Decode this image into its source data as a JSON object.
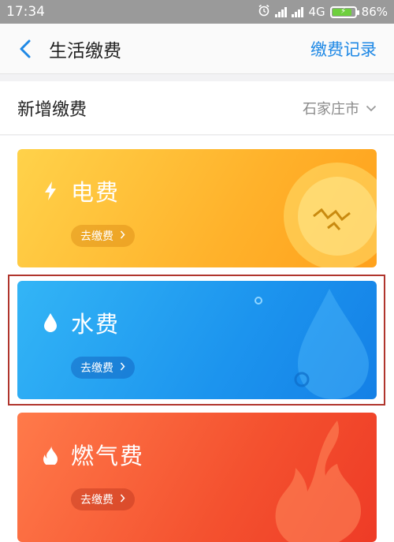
{
  "status_bar": {
    "time": "17:34",
    "network": "4G",
    "battery": "86%"
  },
  "header": {
    "title": "生活缴费",
    "right_link": "缴费记录"
  },
  "sub_header": {
    "title": "新增缴费",
    "city": "石家庄市"
  },
  "cards": [
    {
      "name": "电费",
      "action": "去缴费",
      "icon": "lightning-icon",
      "color": "#ffb22b"
    },
    {
      "name": "水费",
      "action": "去缴费",
      "icon": "water-drop-icon",
      "color": "#1c94ee"
    },
    {
      "name": "燃气费",
      "action": "去缴费",
      "icon": "flame-icon",
      "color": "#f4512f"
    }
  ],
  "colors": {
    "accent": "#1e88e5",
    "highlight": "#b0352d"
  }
}
